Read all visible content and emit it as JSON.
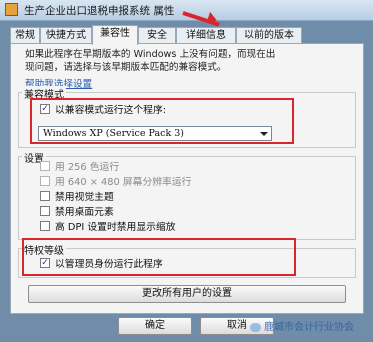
{
  "window": {
    "title": "生产企业出口退税申报系统 属性"
  },
  "tabs": [
    {
      "label": "常规"
    },
    {
      "label": "快捷方式"
    },
    {
      "label": "兼容性"
    },
    {
      "label": "安全"
    },
    {
      "label": "详细信息"
    },
    {
      "label": "以前的版本"
    }
  ],
  "intro": {
    "line1": "如果此程序在早期版本的 Windows 上没有问题，而现在出",
    "line2": "现问题，请选择与该早期版本匹配的兼容模式。"
  },
  "help_link": "帮助我选择设置",
  "compat_mode": {
    "group_label": "兼容模式",
    "checkbox_label": "以兼容模式运行这个程序:",
    "checked": true,
    "selected_os": "Windows XP (Service Pack 3)"
  },
  "settings": {
    "group_label": "设置",
    "items": [
      {
        "label": "用 256 色运行",
        "checked": false
      },
      {
        "label": "用 640 × 480 屏幕分辨率运行",
        "checked": false
      },
      {
        "label": "禁用视觉主题",
        "checked": false
      },
      {
        "label": "禁用桌面元素",
        "checked": false
      },
      {
        "label": "高 DPI 设置时禁用显示缩放",
        "checked": false
      }
    ]
  },
  "privilege": {
    "group_label": "特权等级",
    "checkbox_label": "以管理员身份运行此程序",
    "checked": true
  },
  "buttons": {
    "change_all_users": "更改所有用户的设置",
    "ok": "确定",
    "cancel": "取消"
  },
  "watermark": "鹿城市会计行业协会",
  "colors": {
    "annotation_red": "#d8262c",
    "link_blue": "#2a5db0"
  }
}
